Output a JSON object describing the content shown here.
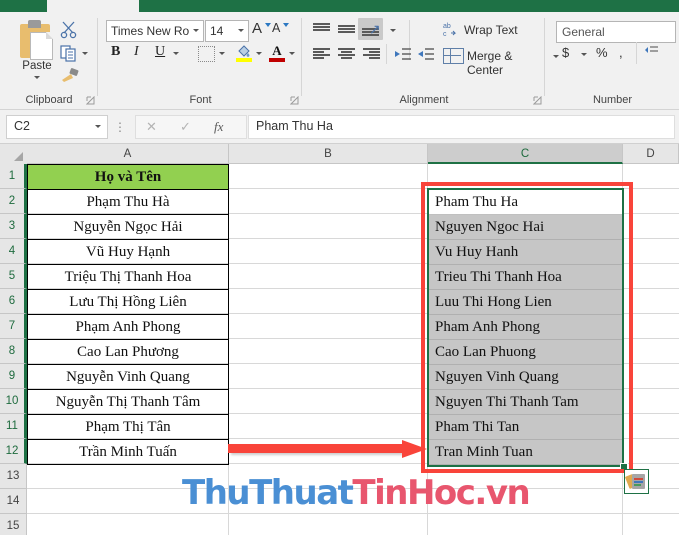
{
  "ribbon": {
    "active_tab": "",
    "groups": [
      {
        "label": "Clipboard"
      },
      {
        "label": "Font"
      },
      {
        "label": "Alignment"
      },
      {
        "label": "Number"
      }
    ],
    "clipboard": {
      "paste_label": "Paste",
      "cut_icon": "scissors-icon",
      "copy_icon": "copy-icon",
      "format_painter_icon": "format-painter-icon"
    },
    "font": {
      "font_name": "Times New Roma",
      "font_size": "14",
      "grow_label": "A",
      "shrink_label": "A",
      "bold_label": "B",
      "italic_label": "I",
      "underline_label": "U",
      "fill_color": "#ffff00",
      "font_color": "#c00000"
    },
    "alignment": {
      "wrap_text_label": "Wrap Text",
      "merge_center_label": "Merge & Center"
    },
    "number": {
      "format_value": "General",
      "currency_label": "$",
      "percent_label": "%",
      "comma_label": ","
    }
  },
  "formula_bar": {
    "name_box": "C2",
    "cancel_icon": "cancel-x-icon",
    "enter_icon": "enter-check-icon",
    "function_icon": "fx",
    "formula_value": "Pham Thu Ha"
  },
  "sheet": {
    "columns": [
      "A",
      "B",
      "C",
      "D"
    ],
    "selected_column": "C",
    "rows": [
      "1",
      "2",
      "3",
      "4",
      "5",
      "6",
      "7",
      "8",
      "9",
      "10",
      "11",
      "12",
      "13",
      "14",
      "15"
    ],
    "column_a": {
      "header": "Họ và Tên",
      "values": [
        "Phạm Thu Hà",
        "Nguyễn Ngọc Hải",
        "Vũ Huy Hạnh",
        "Triệu Thị Thanh Hoa",
        "Lưu Thị Hồng Liên",
        "Phạm Anh Phong",
        "Cao Lan Phương",
        "Nguyễn Vinh Quang",
        "Nguyễn Thị Thanh Tâm",
        "Phạm Thị Tân",
        "Trần Minh Tuấn"
      ],
      "header_fill": "#92d050"
    },
    "column_c": {
      "values": [
        "Pham Thu Ha",
        "Nguyen Ngoc Hai",
        "Vu Huy Hanh",
        "Trieu Thi Thanh Hoa",
        "Luu Thi Hong Lien",
        "Pham Anh Phong",
        "Cao Lan Phuong",
        "Nguyen Vinh Quang",
        "Nguyen Thi Thanh Tam",
        "Pham Thi Tan",
        "Tran Minh Tuan"
      ],
      "selection_range": "C2:C12",
      "active_cell": "C2",
      "selection_color": "#1e7145"
    },
    "paste_options_icon": "paste-options-icon"
  },
  "annotations": {
    "arrow_color": "#f9443a",
    "highlight_box_color": "#f9443a",
    "watermark_part1": "ThuThuat",
    "watermark_part2": "TinHoc.vn"
  }
}
